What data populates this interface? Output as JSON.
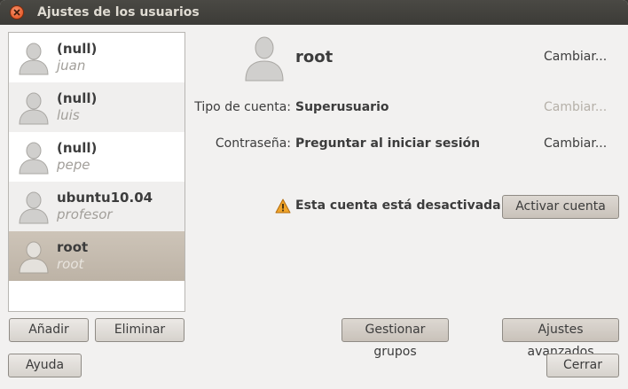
{
  "window": {
    "title": "Ajustes de los usuarios"
  },
  "users": [
    {
      "name": "(null)",
      "login": "juan"
    },
    {
      "name": "(null)",
      "login": "luis"
    },
    {
      "name": "(null)",
      "login": "pepe"
    },
    {
      "name": "ubuntu10.04",
      "login": "profesor"
    },
    {
      "name": "root",
      "login": "root"
    }
  ],
  "list_buttons": {
    "add": "Añadir",
    "remove": "Eliminar"
  },
  "details": {
    "username": "root",
    "change_name": "Cambiar...",
    "account_type_label": "Tipo de cuenta:",
    "account_type_value": "Superusuario",
    "account_type_change": "Cambiar...",
    "password_label": "Contraseña:",
    "password_value": "Preguntar al iniciar sesión",
    "password_change": "Cambiar...",
    "disabled_message": "Esta cuenta está desactivada.",
    "activate_button": "Activar cuenta",
    "groups_button": "Gestionar grupos",
    "advanced_button": "Ajustes avanzados"
  },
  "footer": {
    "help": "Ayuda",
    "close": "Cerrar"
  }
}
